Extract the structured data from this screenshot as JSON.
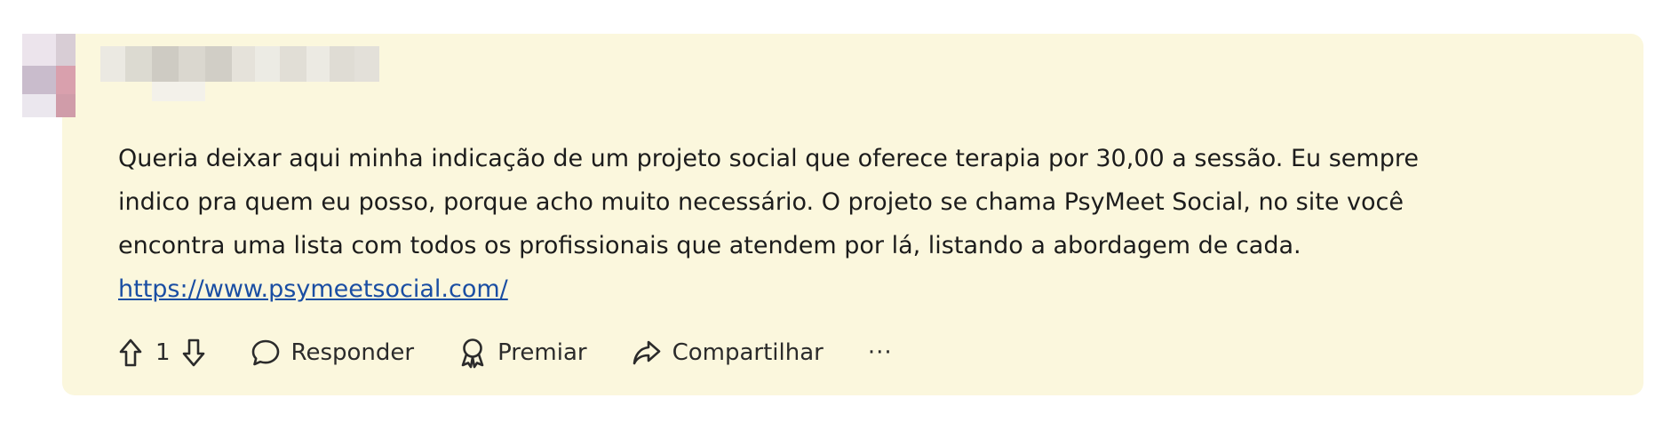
{
  "comment": {
    "author_redacted": true,
    "text_lines": [
      "Queria deixar aqui minha indicação de um projeto social que oferece terapia por 30,00 a sessão. Eu sempre",
      "indico pra quem eu posso, porque acho muito necessário. O projeto se chama PsyMeet Social, no site você",
      "encontra uma lista com todos os profissionais que atendem por lá, listando a abordagem de cada."
    ],
    "link": "https://www.psymeetsocial.com/"
  },
  "actions": {
    "vote_count": "1",
    "reply_label": "Responder",
    "award_label": "Premiar",
    "share_label": "Compartilhar",
    "more_label": "···"
  },
  "colors": {
    "card_background": "#fbf7dd",
    "link": "#1a4ea3",
    "text": "#1c1c1c"
  },
  "icons": [
    "upvote-icon",
    "downvote-icon",
    "comment-bubble-icon",
    "award-icon",
    "share-icon",
    "more-icon"
  ]
}
